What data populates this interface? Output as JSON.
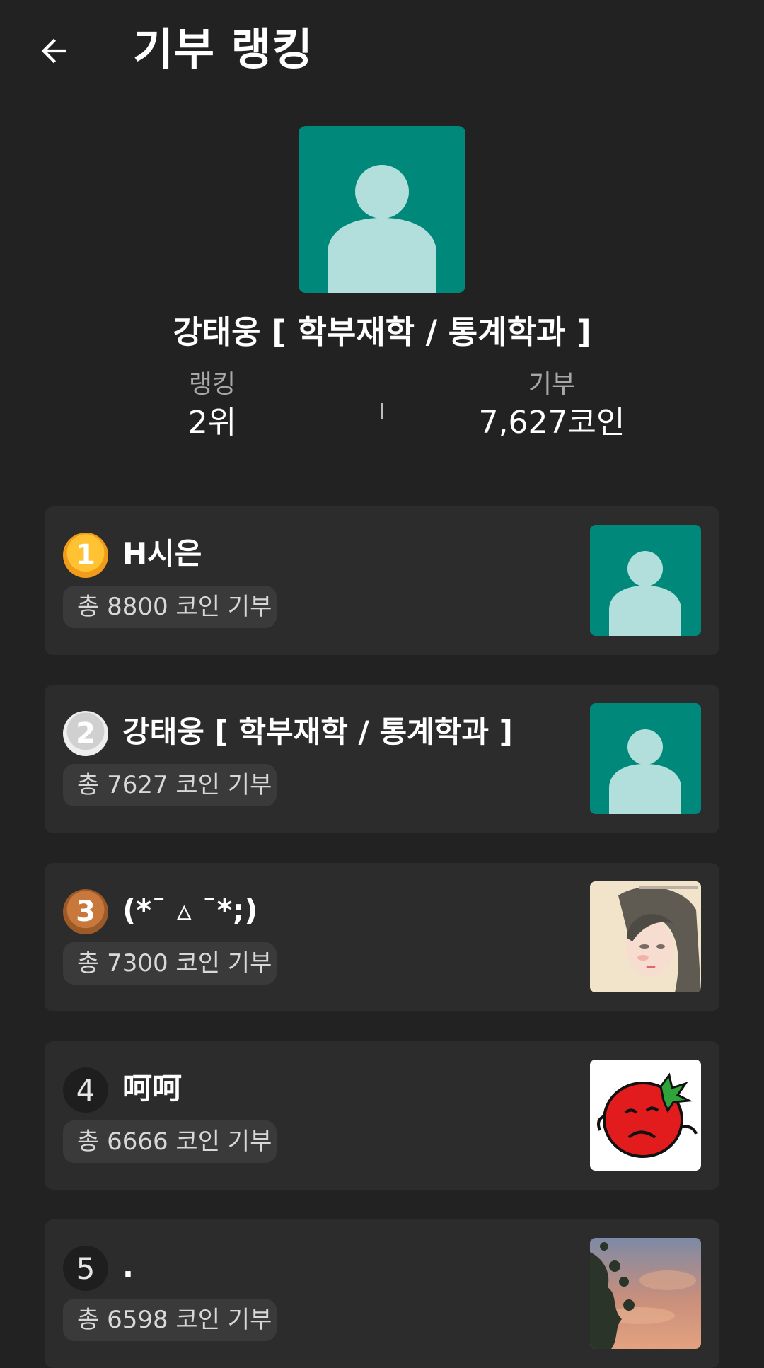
{
  "header": {
    "title": "기부 랭킹"
  },
  "profile": {
    "name": "강태웅 [ 학부재학 / 통계학과 ]",
    "rank_label": "랭킹",
    "rank_value": "2위",
    "donation_label": "기부",
    "donation_value": "7,627코인"
  },
  "ranking": [
    {
      "rank": "1",
      "name": "H시은",
      "total": "총 8800 코인 기부",
      "avatar": "default-avatar"
    },
    {
      "rank": "2",
      "name": "강태웅 [ 학부재학 / 통계학과 ]",
      "total": "총 7627 코인 기부",
      "avatar": "default-avatar"
    },
    {
      "rank": "3",
      "name": "(*¯ ▵ ¯*;)",
      "total": "총 7300 코인 기부",
      "avatar": "illustrated-girl-photo"
    },
    {
      "rank": "4",
      "name": "呵呵",
      "total": "총 6666 코인 기부",
      "avatar": "tomato-cartoon-photo"
    },
    {
      "rank": "5",
      "name": ".",
      "total": "총 6598 코인 기부",
      "avatar": "sunset-tree-photo"
    }
  ],
  "colors": {
    "background": "#222222",
    "card": "#2c2c2c",
    "pill": "#3a3a3a",
    "avatar_bg": "#00897b",
    "avatar_fg": "#b2dfdb",
    "gold": "#f7a823",
    "silver": "#dcdcdc",
    "bronze": "#b56a2e"
  }
}
